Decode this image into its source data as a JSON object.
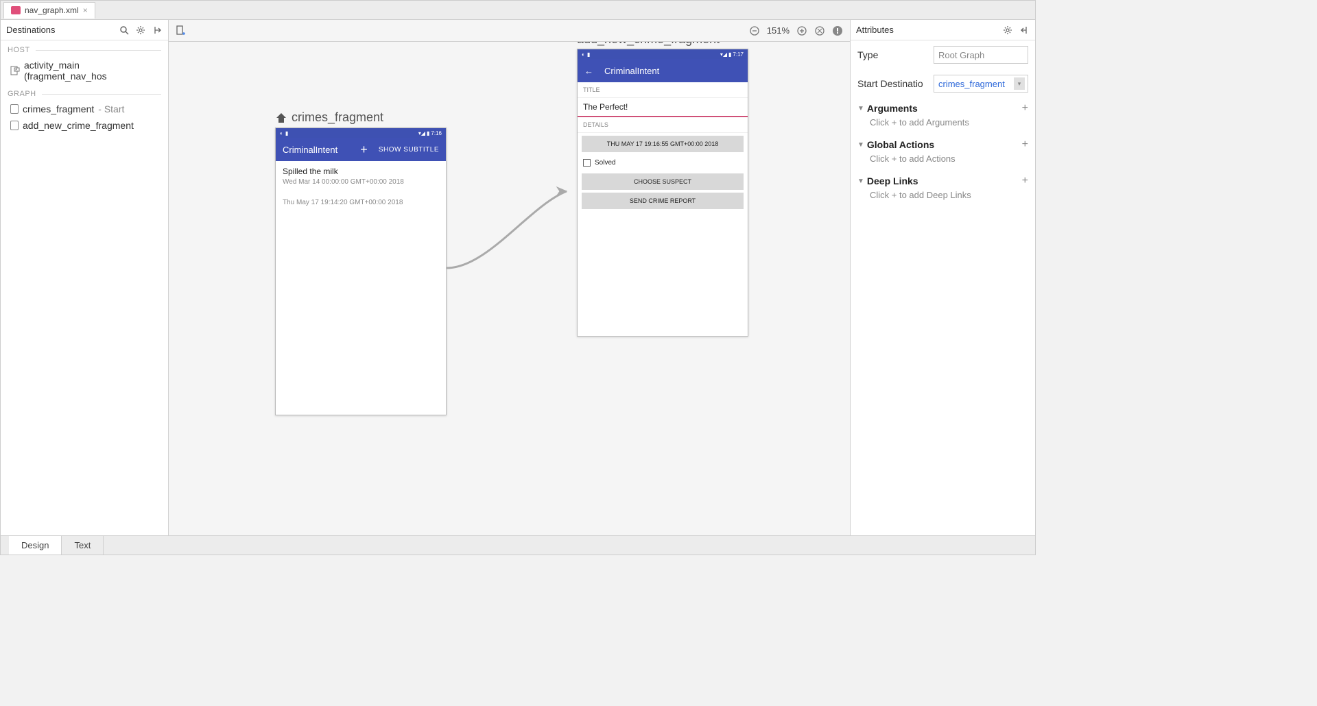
{
  "tab": {
    "filename": "nav_graph.xml"
  },
  "leftPanel": {
    "title": "Destinations",
    "hostLabel": "HOST",
    "graphLabel": "GRAPH",
    "hostItem": "activity_main (fragment_nav_hos",
    "graphItems": [
      {
        "name": "crimes_fragment",
        "suffix": " - Start"
      },
      {
        "name": "add_new_crime_fragment",
        "suffix": ""
      }
    ]
  },
  "canvas": {
    "zoom": "151%",
    "frag1": {
      "label": "crimes_fragment",
      "statusTime": "7:16",
      "appTitle": "CriminalIntent",
      "action": "SHOW SUBTITLE",
      "item1": {
        "title": "Spilled the milk",
        "date": "Wed Mar 14 00:00:00 GMT+00:00 2018"
      },
      "item2": {
        "title": "",
        "date": "Thu May 17 19:14:20 GMT+00:00 2018"
      }
    },
    "frag2": {
      "label": "add_new_crime_fragment",
      "statusTime": "7:17",
      "appTitle": "CriminalIntent",
      "sectionTitle": "TITLE",
      "titleValue": "The Perfect!",
      "sectionDetails": "DETAILS",
      "dateBtn": "THU MAY 17 19:16:55 GMT+00:00 2018",
      "solved": "Solved",
      "chooseSuspect": "CHOOSE SUSPECT",
      "sendReport": "SEND CRIME REPORT"
    }
  },
  "rightPanel": {
    "title": "Attributes",
    "typeLabel": "Type",
    "typeValue": "Root Graph",
    "startDestLabel": "Start Destinatio",
    "startDestValue": "crimes_fragment",
    "sections": {
      "arguments": {
        "title": "Arguments",
        "hint": "Click + to add Arguments"
      },
      "globalActions": {
        "title": "Global Actions",
        "hint": "Click + to add Actions"
      },
      "deepLinks": {
        "title": "Deep Links",
        "hint": "Click + to add Deep Links"
      }
    }
  },
  "bottomTabs": {
    "design": "Design",
    "text": "Text"
  }
}
